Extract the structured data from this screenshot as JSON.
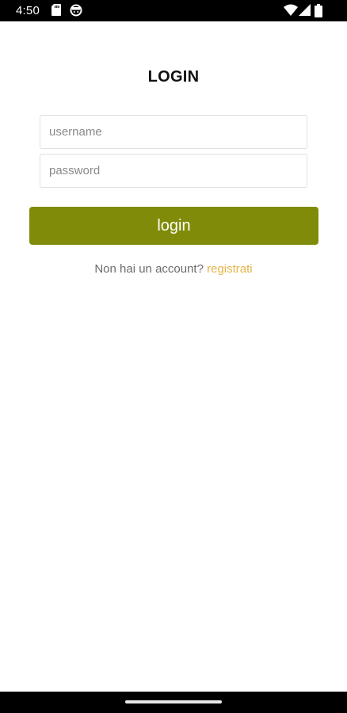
{
  "status_bar": {
    "time": "4:50",
    "icons": [
      "sd-card-icon",
      "face-icon",
      "wifi-icon",
      "signal-icon",
      "battery-icon"
    ]
  },
  "login": {
    "title": "LOGIN",
    "username_placeholder": "username",
    "username_value": "",
    "password_placeholder": "password",
    "password_value": "",
    "button_label": "login",
    "register_prompt": "Non hai un account? ",
    "register_link": "registrati"
  },
  "colors": {
    "accent": "#808c09",
    "link": "#e6b548",
    "status_bar": "#000000"
  }
}
